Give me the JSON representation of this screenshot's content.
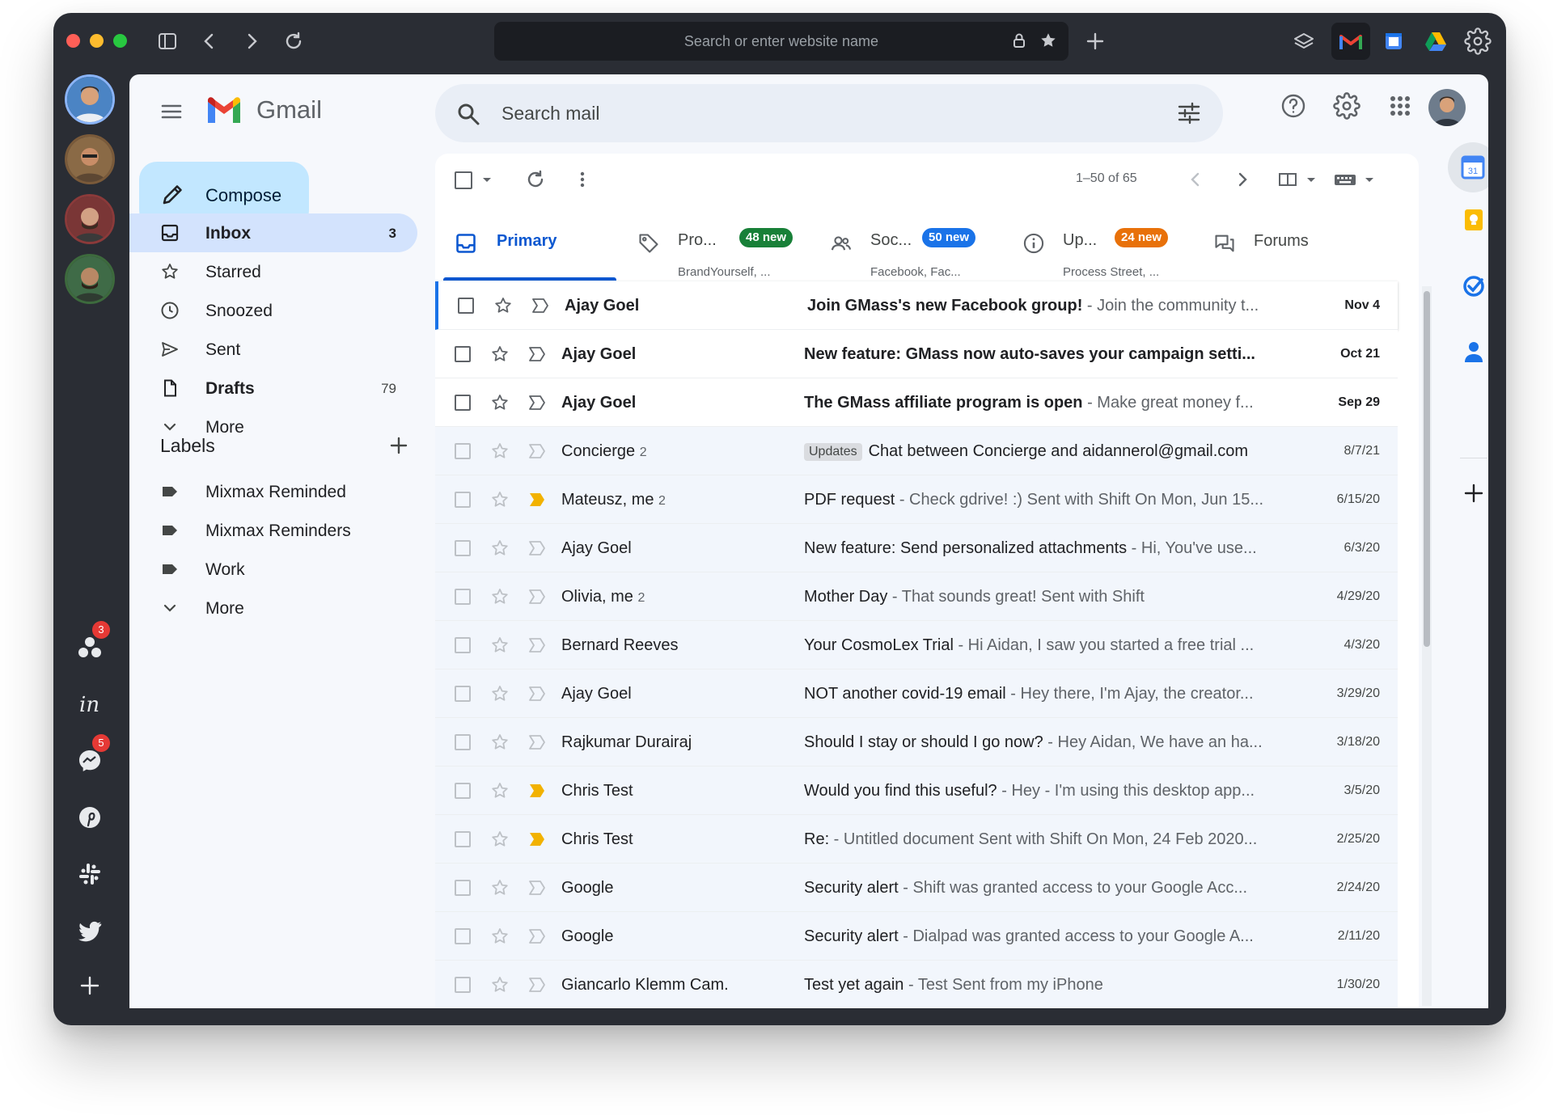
{
  "browser": {
    "url_placeholder": "Search or enter website name"
  },
  "dock": {
    "badges": [
      "3",
      "5"
    ]
  },
  "gmail": {
    "brand": "Gmail",
    "search_placeholder": "Search mail",
    "compose_label": "Compose",
    "nav": [
      {
        "label": "Inbox",
        "count": "3"
      },
      {
        "label": "Starred",
        "count": ""
      },
      {
        "label": "Snoozed",
        "count": ""
      },
      {
        "label": "Sent",
        "count": ""
      },
      {
        "label": "Drafts",
        "count": "79"
      },
      {
        "label": "More",
        "count": ""
      }
    ],
    "labels_title": "Labels",
    "labels": [
      {
        "label": "Mixmax Reminded"
      },
      {
        "label": "Mixmax Reminders"
      },
      {
        "label": "Work"
      },
      {
        "label": "More"
      }
    ],
    "pager": "1–50 of 65",
    "tabs": [
      {
        "name": "Primary",
        "badge": "",
        "sub": ""
      },
      {
        "name": "Pro...",
        "badge": "48 new",
        "sub": "BrandYourself, ...",
        "badge_color": "#188038"
      },
      {
        "name": "Soc...",
        "badge": "50 new",
        "sub": "Facebook, Fac...",
        "badge_color": "#1a73e8"
      },
      {
        "name": "Up...",
        "badge": "24 new",
        "sub": "Process Street, ...",
        "badge_color": "#e8710a"
      },
      {
        "name": "Forums",
        "badge": "",
        "sub": ""
      }
    ],
    "emails": [
      {
        "sender": "Ajay Goel",
        "count": "",
        "tag": "",
        "subject": "Join GMass's new Facebook group!",
        "snippet": " - Join the community t...",
        "date": "Nov 4",
        "unread": true,
        "important": false
      },
      {
        "sender": "Ajay Goel",
        "count": "",
        "tag": "",
        "subject": "New feature: GMass now auto-saves your campaign setti...",
        "snippet": "",
        "date": "Oct 21",
        "unread": true,
        "important": false
      },
      {
        "sender": "Ajay Goel",
        "count": "",
        "tag": "",
        "subject": "The GMass affiliate program is open",
        "snippet": " - Make great money f...",
        "date": "Sep 29",
        "unread": true,
        "important": false
      },
      {
        "sender": "Concierge",
        "count": "2",
        "tag": "Updates",
        "subject": "Chat between Concierge and aidannerol@gmail.com",
        "snippet": "",
        "date": "8/7/21",
        "unread": false,
        "important": false
      },
      {
        "sender": "Mateusz, me",
        "count": "2",
        "tag": "",
        "subject": "PDF request",
        "snippet": " - Check gdrive! :) Sent with Shift On Mon, Jun 15...",
        "date": "6/15/20",
        "unread": false,
        "important": true
      },
      {
        "sender": "Ajay Goel",
        "count": "",
        "tag": "",
        "subject": "New feature: Send personalized attachments",
        "snippet": " - Hi, You've use...",
        "date": "6/3/20",
        "unread": false,
        "important": false
      },
      {
        "sender": "Olivia, me",
        "count": "2",
        "tag": "",
        "subject": "Mother Day",
        "snippet": " - That sounds great! Sent with Shift",
        "date": "4/29/20",
        "unread": false,
        "important": false
      },
      {
        "sender": "Bernard Reeves",
        "count": "",
        "tag": "",
        "subject": "Your CosmoLex Trial",
        "snippet": " - Hi Aidan, I saw you started a free trial ...",
        "date": "4/3/20",
        "unread": false,
        "important": false
      },
      {
        "sender": "Ajay Goel",
        "count": "",
        "tag": "",
        "subject": "NOT another covid-19 email",
        "snippet": " - Hey there, I'm Ajay, the creator...",
        "date": "3/29/20",
        "unread": false,
        "important": false
      },
      {
        "sender": "Rajkumar Durairaj",
        "count": "",
        "tag": "",
        "subject": "Should I stay or should I go now?",
        "snippet": " - Hey Aidan, We have an ha...",
        "date": "3/18/20",
        "unread": false,
        "important": false
      },
      {
        "sender": "Chris Test",
        "count": "",
        "tag": "",
        "subject": "Would you find this useful?",
        "snippet": " - Hey - I'm using this desktop app...",
        "date": "3/5/20",
        "unread": false,
        "important": true
      },
      {
        "sender": "Chris Test",
        "count": "",
        "tag": "",
        "subject": "Re:",
        "snippet": " - Untitled document Sent with Shift On Mon, 24 Feb 2020...",
        "date": "2/25/20",
        "unread": false,
        "important": true
      },
      {
        "sender": "Google",
        "count": "",
        "tag": "",
        "subject": "Security alert",
        "snippet": " - Shift was granted access to your Google Acc...",
        "date": "2/24/20",
        "unread": false,
        "important": false
      },
      {
        "sender": "Google",
        "count": "",
        "tag": "",
        "subject": "Security alert",
        "snippet": " - Dialpad was granted access to your Google A...",
        "date": "2/11/20",
        "unread": false,
        "important": false
      },
      {
        "sender": "Giancarlo Klemm Cam.",
        "count": "",
        "tag": "",
        "subject": "Test yet again",
        "snippet": " - Test Sent from my iPhone",
        "date": "1/30/20",
        "unread": false,
        "important": false
      }
    ]
  },
  "colors": {
    "accent": "#0b57d0",
    "compose_bg": "#c2e7ff",
    "active_nav_bg": "#d3e3fd",
    "important_marker": "#f2b200"
  }
}
